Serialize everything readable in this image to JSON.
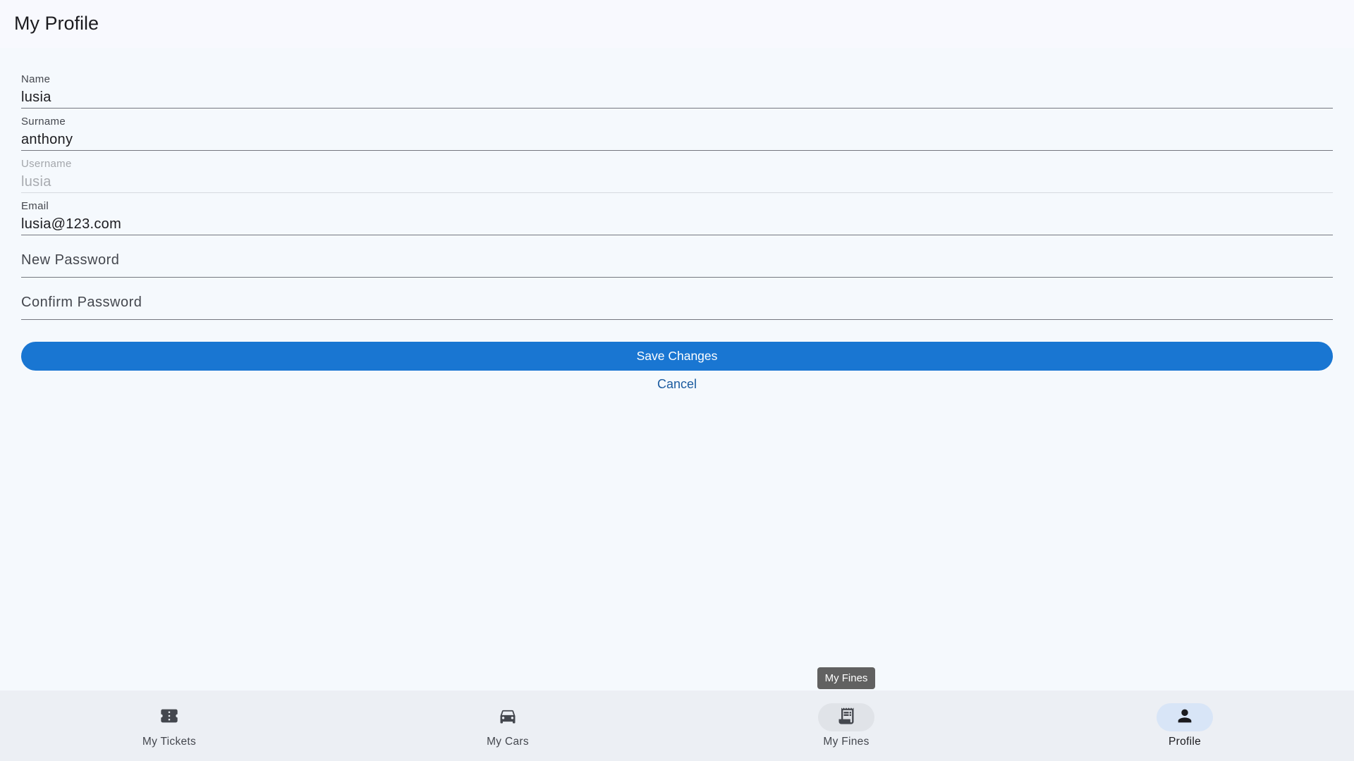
{
  "app_bar": {
    "title": "My Profile"
  },
  "form": {
    "name": {
      "label": "Name",
      "value": "lusia"
    },
    "surname": {
      "label": "Surname",
      "value": "anthony"
    },
    "username": {
      "label": "Username",
      "value": "lusia",
      "disabled": true
    },
    "email": {
      "label": "Email",
      "value": "lusia@123.com"
    },
    "new_password": {
      "placeholder": "New Password"
    },
    "confirm_password": {
      "placeholder": "Confirm Password"
    }
  },
  "actions": {
    "save_label": "Save Changes",
    "cancel_label": "Cancel"
  },
  "colors": {
    "primary": "#1976d2",
    "cancel_text": "#1c5ca0",
    "nav_active": "#d8e5f7"
  },
  "bottom_nav": {
    "items": [
      {
        "label": "My Tickets",
        "icon": "ticket-icon"
      },
      {
        "label": "My Cars",
        "icon": "car-icon"
      },
      {
        "label": "My Fines",
        "icon": "receipt-icon"
      },
      {
        "label": "Profile",
        "icon": "person-icon",
        "active": true
      }
    ]
  },
  "tooltip": {
    "text": "My Fines"
  }
}
